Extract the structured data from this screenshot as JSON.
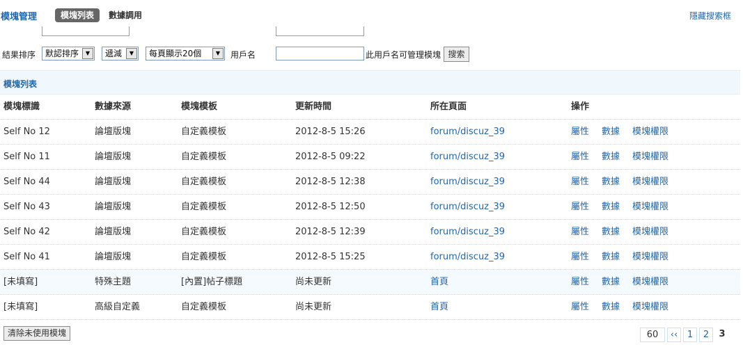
{
  "header": {
    "title": "模塊管理",
    "tabs": [
      {
        "label": "模塊列表",
        "active": true
      },
      {
        "label": "數據調用",
        "active": false
      }
    ],
    "hide_search": "隱藏搜索框"
  },
  "filters": {
    "sort_label": "結果排序",
    "sort_field": "默認排序",
    "sort_order": "遞減",
    "per_page": "每頁顯示20個",
    "username_label": "用戶名",
    "username_value": "",
    "username_hint": "此用戶名可管理模塊",
    "search_button": "搜索"
  },
  "section": {
    "title": "模塊列表"
  },
  "table": {
    "headers": [
      "模塊標識",
      "數據來源",
      "模塊模板",
      "更新時間",
      "所在頁面",
      "操作"
    ],
    "rows": [
      {
        "id": "Self No 12",
        "source": "論壇版塊",
        "template": "自定義模板",
        "updated": "2012-8-5 15:26",
        "page": "forum/discuz_39"
      },
      {
        "id": "Self No 11",
        "source": "論壇版塊",
        "template": "自定義模板",
        "updated": "2012-8-5 09:22",
        "page": "forum/discuz_39"
      },
      {
        "id": "Self No 44",
        "source": "論壇版塊",
        "template": "自定義模板",
        "updated": "2012-8-5 12:38",
        "page": "forum/discuz_39"
      },
      {
        "id": "Self No 43",
        "source": "論壇版塊",
        "template": "自定義模板",
        "updated": "2012-8-5 12:50",
        "page": "forum/discuz_39"
      },
      {
        "id": "Self No 42",
        "source": "論壇版塊",
        "template": "自定義模板",
        "updated": "2012-8-5 12:39",
        "page": "forum/discuz_39"
      },
      {
        "id": "Self No 41",
        "source": "論壇版塊",
        "template": "自定義模板",
        "updated": "2012-8-5 15:25",
        "page": "forum/discuz_39"
      },
      {
        "id": "[未填寫]",
        "source": "特殊主題",
        "template": "[內置]帖子標題",
        "updated": "尚未更新",
        "page": "首頁"
      },
      {
        "id": "[未填寫]",
        "source": "高級自定義",
        "template": "自定義模板",
        "updated": "尚未更新",
        "page": "首頁"
      }
    ],
    "actions": [
      "屬性",
      "數據",
      "模塊權限"
    ]
  },
  "footer": {
    "clear_button": "清除未使用模塊",
    "pager": {
      "total": "60",
      "prev": "‹‹",
      "pages": [
        "1",
        "2"
      ],
      "current": "3"
    }
  },
  "colors": {
    "link": "#2366a8",
    "section_bg": "#f0f7fd",
    "tab_active_bg": "#666666"
  }
}
